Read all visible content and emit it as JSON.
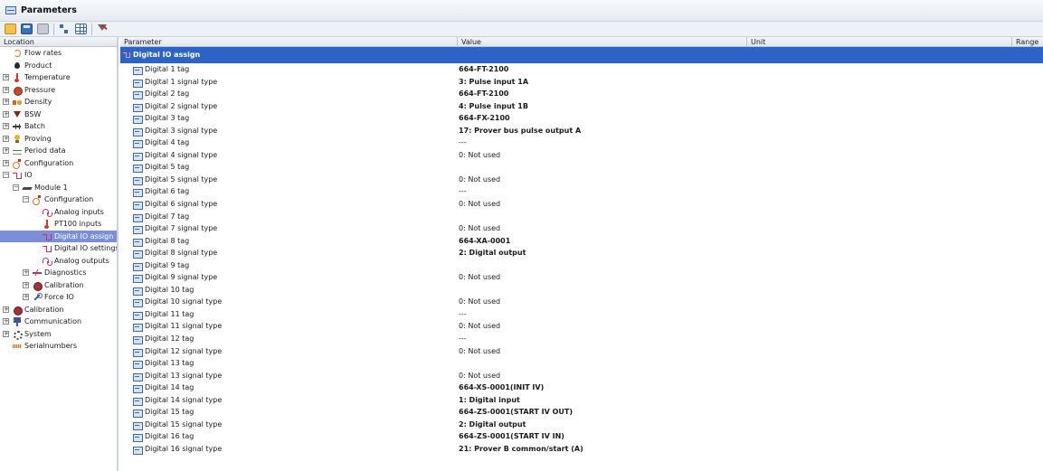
{
  "window": {
    "title": "Parameters"
  },
  "toolbar": {
    "icons": [
      "open-icon",
      "save-icon",
      "print-icon",
      "tree-view-icon",
      "grid-view-icon",
      "filter-icon"
    ]
  },
  "left_panel": {
    "header": "Location",
    "items": [
      {
        "label": "Flow rates",
        "icon": "flow-icon",
        "level": 0,
        "expander": ""
      },
      {
        "label": "Product",
        "icon": "drop-icon",
        "level": 0,
        "expander": ""
      },
      {
        "label": "Temperature",
        "icon": "thermometer-icon",
        "level": 0,
        "expander": "+"
      },
      {
        "label": "Pressure",
        "icon": "pressure-icon",
        "level": 0,
        "expander": "+"
      },
      {
        "label": "Density",
        "icon": "density-icon",
        "level": 0,
        "expander": "+"
      },
      {
        "label": "BSW",
        "icon": "funnel-icon",
        "level": 0,
        "expander": "+"
      },
      {
        "label": "Batch",
        "icon": "batch-icon",
        "level": 0,
        "expander": "+"
      },
      {
        "label": "Proving",
        "icon": "bulb-icon",
        "level": 0,
        "expander": "+"
      },
      {
        "label": "Period data",
        "icon": "wave-icon",
        "level": 0,
        "expander": "+"
      },
      {
        "label": "Configuration",
        "icon": "configuration-icon",
        "level": 0,
        "expander": "+"
      },
      {
        "label": "IO",
        "icon": "io-icon",
        "level": 0,
        "expander": "−"
      },
      {
        "label": "Module 1",
        "icon": "module-icon",
        "level": 1,
        "expander": "−"
      },
      {
        "label": "Configuration",
        "icon": "configuration-icon",
        "level": 2,
        "expander": "−"
      },
      {
        "label": "Analog inputs",
        "icon": "sine-icon",
        "level": 3,
        "expander": ""
      },
      {
        "label": "PT100 inputs",
        "icon": "thermometer-icon",
        "level": 3,
        "expander": ""
      },
      {
        "label": "Digital IO assign",
        "icon": "io-icon",
        "level": 3,
        "expander": "",
        "selected": true
      },
      {
        "label": "Digital IO settings",
        "icon": "io-icon",
        "level": 3,
        "expander": ""
      },
      {
        "label": "Analog outputs",
        "icon": "sine-icon",
        "level": 3,
        "expander": ""
      },
      {
        "label": "Diagnostics",
        "icon": "pulse-icon",
        "level": 2,
        "expander": "+"
      },
      {
        "label": "Calibration",
        "icon": "calibration-icon",
        "level": 2,
        "expander": "+"
      },
      {
        "label": "Force IO",
        "icon": "wrench-icon",
        "level": 2,
        "expander": "+"
      },
      {
        "label": "Calibration",
        "icon": "calibration-icon",
        "level": 0,
        "expander": "+"
      },
      {
        "label": "Communication",
        "icon": "communication-icon",
        "level": 0,
        "expander": "+"
      },
      {
        "label": "System",
        "icon": "gear-icon",
        "level": 0,
        "expander": "+"
      },
      {
        "label": "Serialnumbers",
        "icon": "serial-icon",
        "level": 0,
        "expander": ""
      }
    ]
  },
  "grid": {
    "columns": {
      "parameter": "Parameter",
      "value": "Value",
      "unit": "Unit",
      "range": "Range"
    },
    "group_title": "Digital IO assign",
    "rows": [
      {
        "name": "Digital 1 tag",
        "value": "664-FT-2100",
        "bold": true
      },
      {
        "name": "Digital 1 signal type",
        "value": "3: Pulse input 1A",
        "bold": true
      },
      {
        "name": "Digital 2 tag",
        "value": "664-FT-2100",
        "bold": true
      },
      {
        "name": "Digital 2 signal type",
        "value": "4: Pulse input 1B",
        "bold": true
      },
      {
        "name": "Digital 3 tag",
        "value": "664-FX-2100",
        "bold": true
      },
      {
        "name": "Digital 3 signal type",
        "value": "17: Prover bus pulse output A",
        "bold": true
      },
      {
        "name": "Digital 4 tag",
        "value": "---",
        "bold": false
      },
      {
        "name": "Digital 4 signal type",
        "value": "0: Not used",
        "bold": false
      },
      {
        "name": "Digital 5 tag",
        "value": "",
        "bold": false
      },
      {
        "name": "Digital 5 signal type",
        "value": "0: Not used",
        "bold": false
      },
      {
        "name": "Digital 6 tag",
        "value": "---",
        "bold": false
      },
      {
        "name": "Digital 6 signal type",
        "value": "0: Not used",
        "bold": false
      },
      {
        "name": "Digital 7 tag",
        "value": "",
        "bold": false
      },
      {
        "name": "Digital 7 signal type",
        "value": "0: Not used",
        "bold": false
      },
      {
        "name": "Digital 8 tag",
        "value": "664-XA-0001",
        "bold": true
      },
      {
        "name": "Digital 8 signal type",
        "value": "2: Digital output",
        "bold": true
      },
      {
        "name": "Digital 9 tag",
        "value": "",
        "bold": false
      },
      {
        "name": "Digital 9 signal type",
        "value": "0: Not used",
        "bold": false
      },
      {
        "name": "Digital 10 tag",
        "value": "",
        "bold": false
      },
      {
        "name": "Digital 10 signal type",
        "value": "0: Not used",
        "bold": false
      },
      {
        "name": "Digital 11 tag",
        "value": "---",
        "bold": false
      },
      {
        "name": "Digital 11 signal type",
        "value": "0: Not used",
        "bold": false
      },
      {
        "name": "Digital 12 tag",
        "value": "---",
        "bold": false
      },
      {
        "name": "Digital 12 signal type",
        "value": "0: Not used",
        "bold": false
      },
      {
        "name": "Digital 13 tag",
        "value": "",
        "bold": false
      },
      {
        "name": "Digital 13 signal type",
        "value": "0: Not used",
        "bold": false
      },
      {
        "name": "Digital 14 tag",
        "value": "664-XS-0001(INIT IV)",
        "bold": true
      },
      {
        "name": "Digital 14 signal type",
        "value": "1: Digital input",
        "bold": true
      },
      {
        "name": "Digital 15 tag",
        "value": "664-ZS-0001(START IV OUT)",
        "bold": true
      },
      {
        "name": "Digital 15 signal type",
        "value": "2: Digital output",
        "bold": true
      },
      {
        "name": "Digital 16 tag",
        "value": "664-ZS-0001(START IV IN)",
        "bold": true
      },
      {
        "name": "Digital 16 signal type",
        "value": "21: Prover B common/start (A)",
        "bold": true
      }
    ]
  }
}
